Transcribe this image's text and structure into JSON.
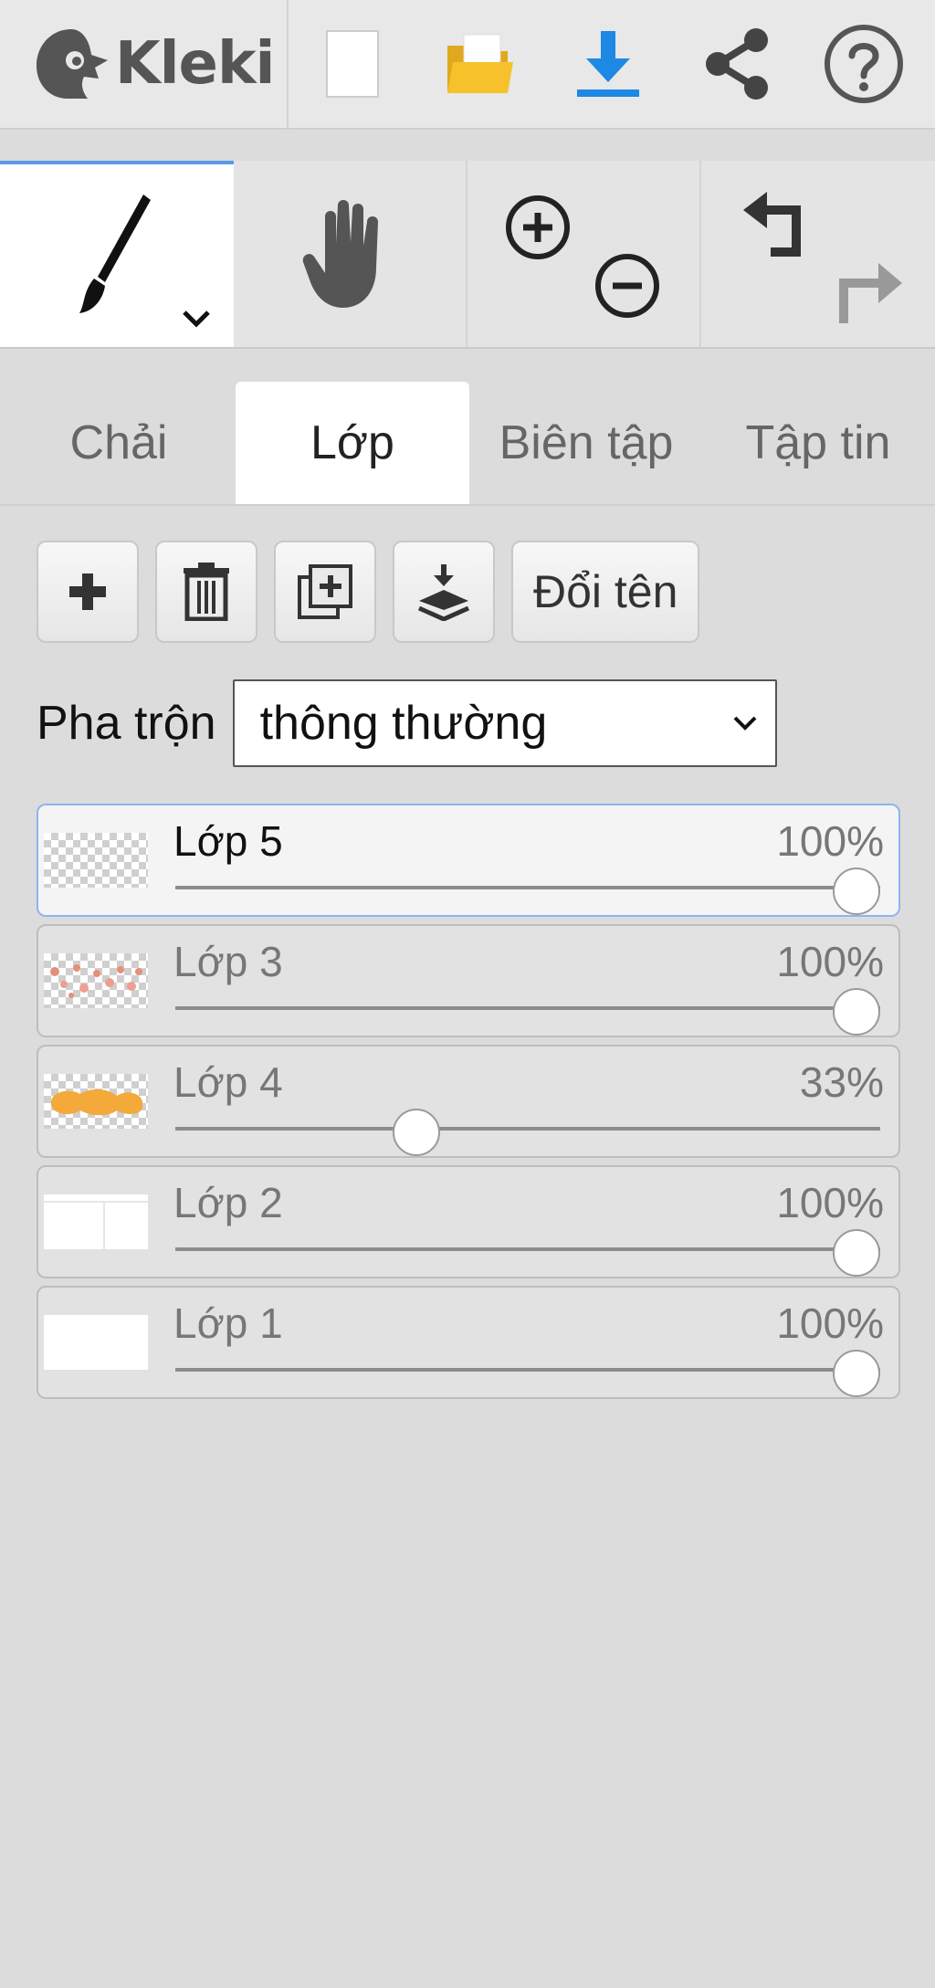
{
  "app": {
    "name": "Kleki"
  },
  "topbar": {
    "icons": [
      "new-file-icon",
      "open-file-icon",
      "download-icon",
      "share-icon",
      "help-icon"
    ],
    "accent_color": "#1e88e5"
  },
  "tools": {
    "items": [
      "brush-tool",
      "hand-tool",
      "zoom-in",
      "zoom-out",
      "undo",
      "redo"
    ]
  },
  "tabs": [
    {
      "label": "Chải",
      "active": false
    },
    {
      "label": "Lớp",
      "active": true
    },
    {
      "label": "Biên tập",
      "active": false
    },
    {
      "label": "Tập tin",
      "active": false
    }
  ],
  "layer_actions": {
    "rename_label": "Đổi tên"
  },
  "blend": {
    "label": "Pha trộn",
    "value": "thông thường"
  },
  "layers": [
    {
      "name": "Lớp 5",
      "opacity_text": "100%",
      "opacity": 1.0,
      "active": true
    },
    {
      "name": "Lớp 3",
      "opacity_text": "100%",
      "opacity": 1.0,
      "active": false
    },
    {
      "name": "Lớp 4",
      "opacity_text": "33%",
      "opacity": 0.33,
      "active": false
    },
    {
      "name": "Lớp 2",
      "opacity_text": "100%",
      "opacity": 1.0,
      "active": false
    },
    {
      "name": "Lớp 1",
      "opacity_text": "100%",
      "opacity": 1.0,
      "active": false
    }
  ]
}
